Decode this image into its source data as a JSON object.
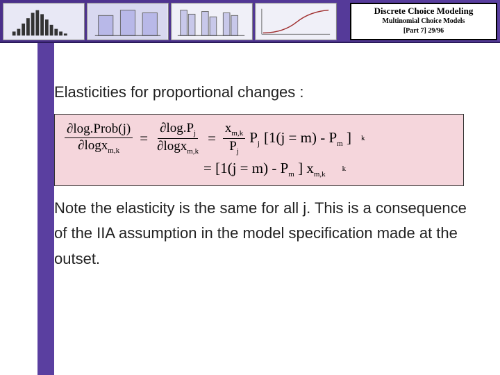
{
  "header": {
    "title_main": "Discrete Choice Modeling",
    "title_sub": "Multinomial Choice Models",
    "title_part": "[Part 7]   29/96"
  },
  "content": {
    "heading": "Elasticities for proportional changes :",
    "formula": {
      "lhs_num": "∂log.Prob(j)",
      "lhs_den_prefix": "∂logx",
      "lhs_den_sub": "m,k",
      "mid_num_prefix": "∂log.P",
      "mid_num_sub": "j",
      "mid_den_prefix": "∂logx",
      "mid_den_sub": "m,k",
      "rhs_frac_num_prefix": "x",
      "rhs_frac_num_sub": "m,k",
      "rhs_frac_den_prefix": "P",
      "rhs_frac_den_sub": "j",
      "rhs_P_prefix": "P",
      "rhs_P_sub": "j",
      "rhs_bracket": "[1(j = m) - P",
      "rhs_bracket_sub": "m",
      "rhs_bracket_close": " ]",
      "rhs_trail_sub": "k",
      "line2_eq": "= [1(j = m) - P",
      "line2_sub1": "m",
      "line2_mid": " ] x",
      "line2_sub2": "m,k",
      "line2_trail_sub": "k"
    },
    "note": "Note the elasticity is the same for all j.  This is a consequence of the IIA assumption in the model specification made at the outset."
  },
  "thumbs": {
    "t1": "histogram-thumb",
    "t2": "barchart-thumb",
    "t3": "grouped-bars-thumb",
    "t4": "curve-thumb"
  }
}
